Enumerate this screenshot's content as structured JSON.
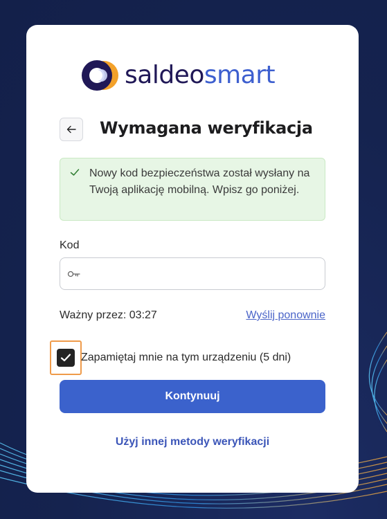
{
  "colors": {
    "page_background": "#15234f",
    "card_background": "#ffffff",
    "brand_dark": "#201857",
    "brand_blue": "#3d5fcf",
    "primary_button": "#3b62cc",
    "link": "#4a64c8",
    "success_background": "#e7f6e5",
    "focus_ring": "#ef9b4a"
  },
  "logo": {
    "part1": "saldeo",
    "part2": "smart"
  },
  "header": {
    "back_icon": "arrow-left-icon",
    "title": "Wymagana weryfikacja"
  },
  "alert": {
    "icon": "check-icon",
    "message": "Nowy kod bezpieczeństwa został wysłany na Twoją aplikację mobilną. Wpisz go poniżej."
  },
  "code_field": {
    "label": "Kod",
    "icon": "key-icon",
    "value": ""
  },
  "timer": {
    "text": "Ważny przez: 03:27",
    "resend_label": "Wyślij ponownie"
  },
  "remember": {
    "checked": true,
    "label": "Zapamiętaj mnie na tym urządzeniu (5 dni)"
  },
  "actions": {
    "submit_label": "Kontynuuj",
    "alternative_label": "Użyj innej metody weryfikacji"
  }
}
